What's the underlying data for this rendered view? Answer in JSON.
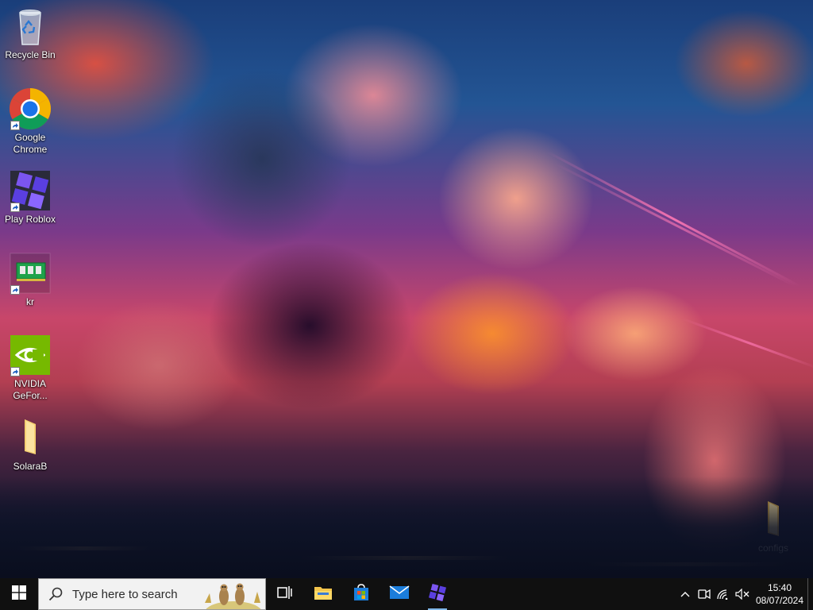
{
  "desktop": {
    "icons": [
      {
        "label": "Recycle Bin",
        "icon": "recycle-bin-icon"
      },
      {
        "label": "Google Chrome",
        "icon": "chrome-icon"
      },
      {
        "label": "Play Roblox",
        "icon": "roblox-icon"
      },
      {
        "label": "kr",
        "icon": "memory-module-icon"
      },
      {
        "label": "NVIDIA GeFor...",
        "icon": "nvidia-icon"
      },
      {
        "label": "SolaraB",
        "icon": "folder-icon"
      },
      {
        "label": "configs",
        "icon": "folder-icon"
      }
    ]
  },
  "taskbar": {
    "start_icon": "windows-start-icon",
    "search": {
      "placeholder": "Type here to search",
      "icon": "search-icon",
      "highlight_icon": "meerkats-search-highlight-icon"
    },
    "pinned": [
      {
        "name": "Task View",
        "icon": "task-view-icon"
      },
      {
        "name": "File Explorer",
        "icon": "file-explorer-icon"
      },
      {
        "name": "Microsoft Store",
        "icon": "microsoft-store-icon"
      },
      {
        "name": "Mail",
        "icon": "mail-icon"
      },
      {
        "name": "Roblox",
        "icon": "roblox-icon",
        "running": true
      }
    ],
    "tray": {
      "icons": [
        "chevron-up-icon",
        "meet-now-icon",
        "network-icon",
        "volume-muted-icon"
      ],
      "time": "15:40",
      "date": "08/07/2024"
    }
  },
  "colors": {
    "taskbar_bg": "#101010",
    "search_bg": "#f2f2f2",
    "running_indicator": "#7fb6e8"
  }
}
